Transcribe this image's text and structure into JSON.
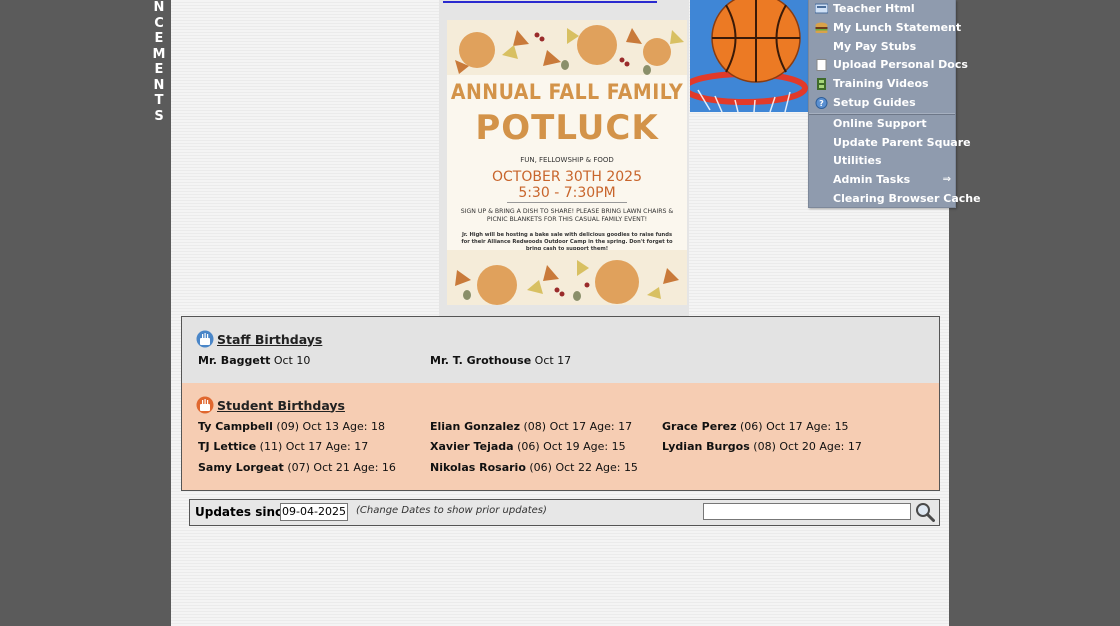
{
  "vertical_word": [
    "N",
    "C",
    "E",
    "M",
    "E",
    "N",
    "T",
    "S"
  ],
  "flyer": {
    "title_line1": "ANNUAL FALL FAMILY",
    "title_line2": "POTLUCK",
    "subtitle": "FUN, FELLOWSHIP & FOOD",
    "date": "OCTOBER 30TH 2025",
    "time": "5:30 - 7:30PM",
    "signup": "SIGN UP & BRING A DISH TO SHARE! PLEASE BRING LAWN CHAIRS & PICNIC BLANKETS FOR THIS CASUAL FAMILY EVENT!",
    "bake_sale": "Jr. High will be hosting a bake sale with delicious goodies to raise funds for their Alliance Redwoods Outdoor Camp in the spring. Don't forget to bring cash to support them!"
  },
  "menu": {
    "items": [
      {
        "label": "Teacher Html",
        "icon": "html-icon"
      },
      {
        "label": "My Lunch Statement",
        "icon": "burger-icon"
      },
      {
        "label": "My Pay Stubs",
        "icon": ""
      },
      {
        "label": "Upload Personal Docs",
        "icon": "document-icon"
      },
      {
        "label": "Training Videos",
        "icon": "film-icon"
      },
      {
        "label": "Setup Guides",
        "icon": "help-icon"
      }
    ],
    "items2": [
      {
        "label": "Online Support"
      },
      {
        "label": "Update Parent Square"
      },
      {
        "label": "Utilities"
      },
      {
        "label": "Admin Tasks",
        "arrow": "⇒"
      },
      {
        "label": "Clearing Browser Cache"
      }
    ]
  },
  "staff_birthdays": {
    "title": "Staff Birthdays",
    "entries": [
      {
        "name": "Mr. Baggett",
        "info": "Oct 10"
      },
      {
        "name": "Mr. T. Grothouse",
        "info": "Oct 17"
      }
    ]
  },
  "student_birthdays": {
    "title": "Student Birthdays",
    "entries": [
      {
        "name": "Ty Campbell",
        "info": "(09) Oct 13 Age: 18"
      },
      {
        "name": "Elian Gonzalez",
        "info": "(08) Oct 17 Age: 17"
      },
      {
        "name": "Grace Perez",
        "info": "(06) Oct 17 Age: 15"
      },
      {
        "name": "TJ Lettice",
        "info": "(11) Oct 17 Age: 17"
      },
      {
        "name": "Xavier Tejada",
        "info": "(06) Oct 19 Age: 15"
      },
      {
        "name": "Lydian Burgos",
        "info": "(08) Oct 20 Age: 17"
      },
      {
        "name": "Samy Lorgeat",
        "info": "(07) Oct 21 Age: 16"
      },
      {
        "name": "Nikolas Rosario",
        "info": "(06) Oct 22 Age: 15"
      }
    ]
  },
  "updates": {
    "label": "Updates since:",
    "date_value": "09-04-2025",
    "note": "(Change Dates to show prior updates)",
    "search_value": ""
  },
  "colors": {
    "page_bg": "#5b5b5b",
    "menu_bg": "#8f9bae",
    "staff_bg": "#e3e3e3",
    "student_bg": "#f6cdb3",
    "flyer_orange": "#d39349"
  }
}
